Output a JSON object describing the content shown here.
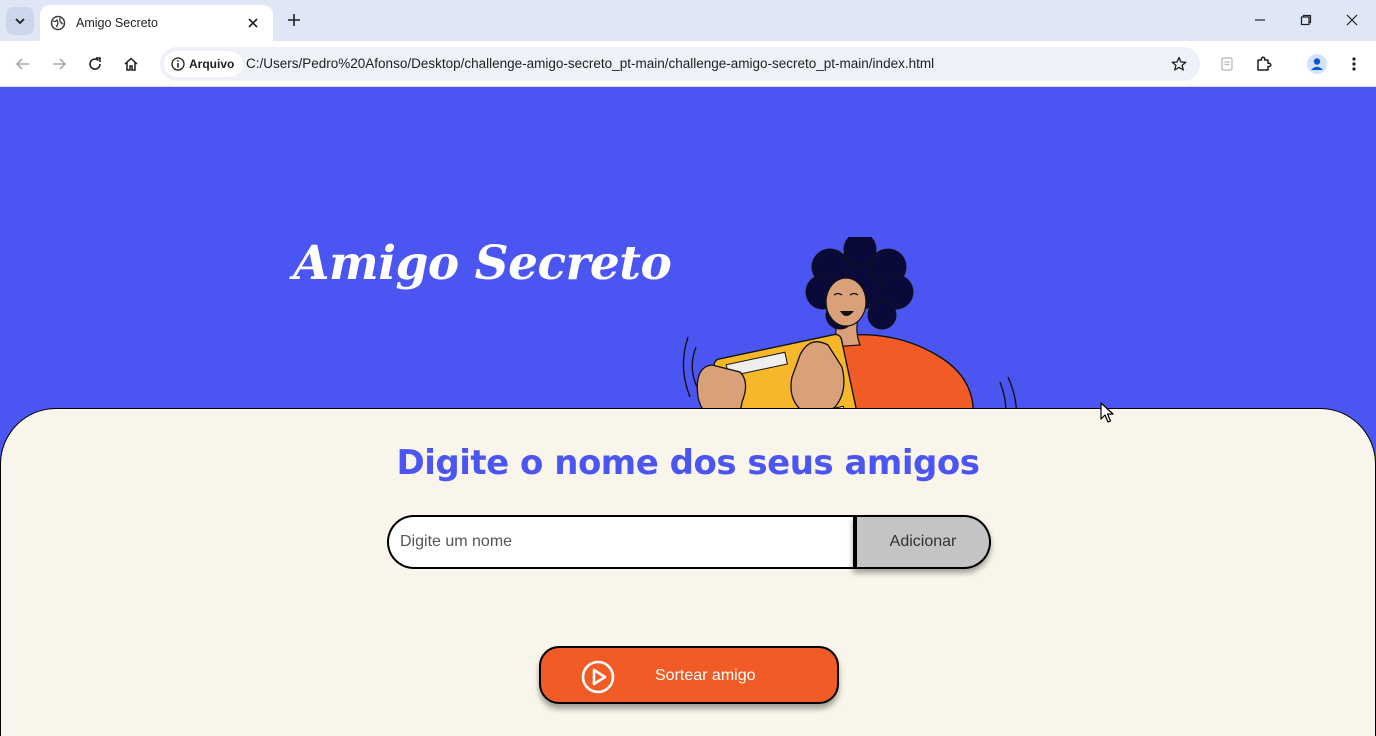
{
  "browser": {
    "tab_title": "Amigo Secreto",
    "site_chip_label": "Arquivo",
    "url": "C:/Users/Pedro%20Afonso/Desktop/challenge-amigo-secreto_pt-main/challenge-amigo-secreto_pt-main/index.html"
  },
  "hero": {
    "title": "Amigo Secreto"
  },
  "main": {
    "section_title": "Digite o nome dos seus amigos",
    "name_input": {
      "placeholder": "Digite um nome",
      "value": ""
    },
    "add_button_label": "Adicionar",
    "draw_button_label": "Sortear amigo"
  },
  "colors": {
    "brand_blue": "#4b56f2",
    "panel_bg": "#f9f5ea",
    "accent_orange": "#f15b25",
    "button_gray": "#c4c4c4"
  },
  "icons": [
    "chevron-down-icon",
    "globe-icon",
    "close-icon",
    "plus-icon",
    "back-icon",
    "forward-icon",
    "reload-icon",
    "home-icon",
    "info-icon",
    "star-icon",
    "extension-icon",
    "profile-icon",
    "menu-icon",
    "play-circle-icon"
  ]
}
